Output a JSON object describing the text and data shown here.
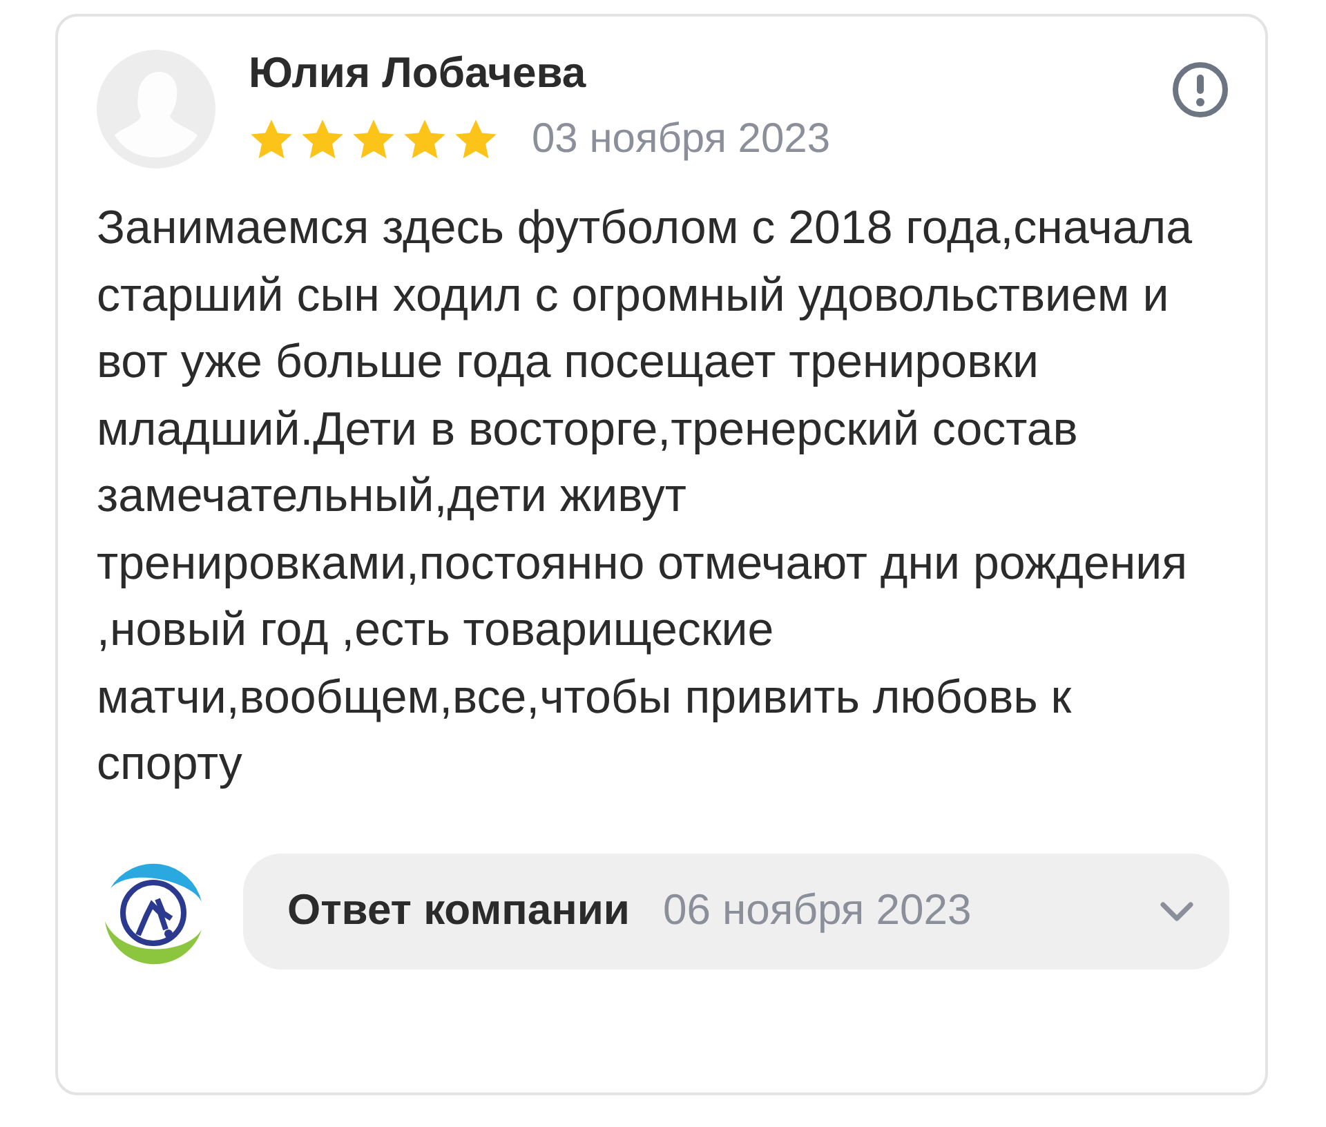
{
  "review": {
    "author": "Юлия Лобачева",
    "stars": 5,
    "date": "03 ноября 2023",
    "text": "Занимаемся здесь футболом с 2018 года,сначала старший сын ходил с огромный удовольствием и вот уже больше года посещает тренировки младший.Дети в восторге,тренерский состав замечательный,дети живут тренировками,постоянно отмечают дни рождения ,новый год ,есть товарищеские матчи,вообщем,все,чтобы привить любовь к спорту"
  },
  "reply": {
    "label": "Ответ компании",
    "date": "06 ноября 2023",
    "expanded": false
  }
}
